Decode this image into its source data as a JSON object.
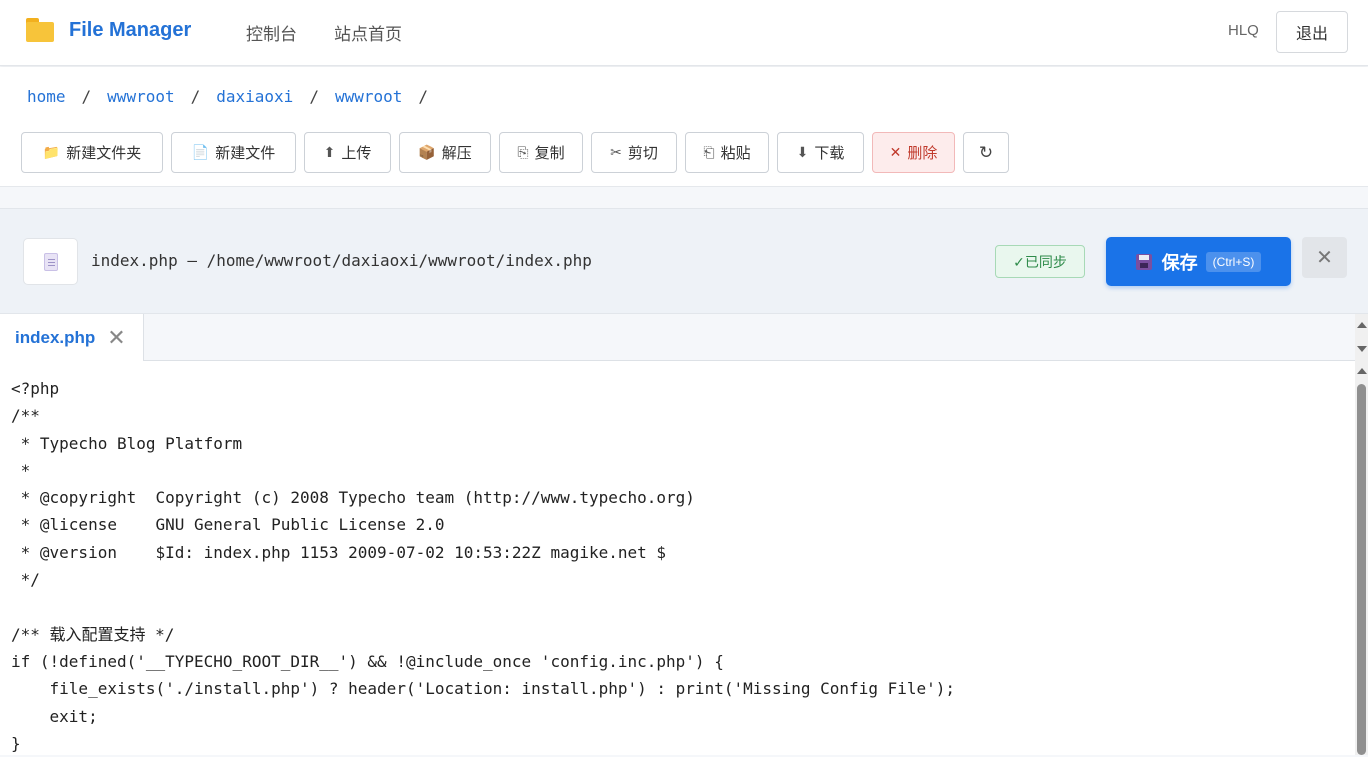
{
  "navbar": {
    "brand": "File Manager",
    "links": [
      "控制台",
      "站点首页"
    ],
    "user": "HLQ",
    "logout": "退出"
  },
  "breadcrumb": [
    "home",
    "wwwroot",
    "daxiaoxi",
    "wwwroot"
  ],
  "breadcrumb_sep": "/",
  "toolbar": [
    {
      "icon": "folder-icon",
      "glyph": "📁",
      "label": "新建文件夹"
    },
    {
      "icon": "file-icon",
      "glyph": "📄",
      "label": "新建文件"
    },
    {
      "icon": "upload-arrow-icon",
      "glyph": "⬆",
      "label": "上传"
    },
    {
      "icon": "package-icon",
      "glyph": "📦",
      "label": "解压"
    },
    {
      "icon": "copy-icon",
      "glyph": "⎘",
      "label": "复制"
    },
    {
      "icon": "scissors-icon",
      "glyph": "✂",
      "label": "剪切"
    },
    {
      "icon": "paste-icon",
      "glyph": "⎗",
      "label": "粘贴"
    },
    {
      "icon": "download-arrow-icon",
      "glyph": "⬇",
      "label": "下载"
    },
    {
      "icon": "cross-icon",
      "glyph": "✕",
      "label": "删除"
    },
    {
      "icon": "refresh-icon",
      "glyph": "↻",
      "label": ""
    }
  ],
  "editor": {
    "filename": "index.php",
    "path": "/home/wwwroot/daxiaoxi/wwwroot/index.php",
    "header_text": "index.php — /home/wwwroot/daxiaoxi/wwwroot/index.php",
    "sync_status": "✓已同步",
    "save_label": "保存",
    "save_shortcut": "(Ctrl+S)",
    "close_glyph": "✕"
  },
  "tabs": [
    {
      "label": "index.php",
      "close_glyph": "✕"
    }
  ],
  "code_lines": [
    "<?php",
    "/**",
    " * Typecho Blog Platform",
    " *",
    " * @copyright  Copyright (c) 2008 Typecho team (http://www.typecho.org)",
    " * @license    GNU General Public License 2.0",
    " * @version    $Id: index.php 1153 2009-07-02 10:53:22Z magike.net $",
    " */",
    "",
    "/** 载入配置支持 */",
    "if (!defined('__TYPECHO_ROOT_DIR__') && !@include_once 'config.inc.php') {",
    "    file_exists('./install.php') ? header('Location: install.php') : print('Missing Config File');",
    "    exit;",
    "}"
  ],
  "colors": {
    "accent": "#1a73e8",
    "link": "#2472d6",
    "sync_green": "#2e8b4a",
    "danger": "#c0392b"
  }
}
